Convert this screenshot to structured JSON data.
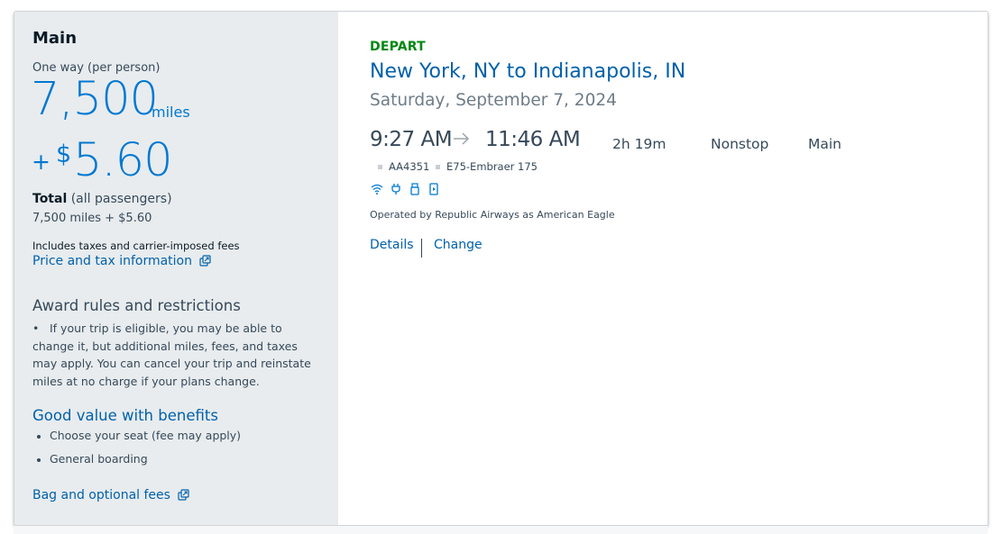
{
  "fare": {
    "cabin_title": "Main",
    "one_way_label": "One way (per person)",
    "miles": "7,500",
    "miles_unit": "miles",
    "plus": "+",
    "currency_symbol": "$",
    "cash": "5.60",
    "total_label": "Total",
    "total_suffix": "(all passengers)",
    "total_value": "7,500 miles + $5.60",
    "includes_text": "Includes taxes and carrier-imposed fees",
    "price_tax_link": "Price and tax information"
  },
  "award": {
    "title": "Award rules and restrictions",
    "rule_text": "If your trip is eligible, you may be able to change it, but additional miles, fees, and taxes may apply. You can cancel your trip and reinstate miles at no charge if your plans change."
  },
  "benefits": {
    "title": "Good value with benefits",
    "items": [
      "Choose your seat (fee may apply)",
      "General boarding"
    ]
  },
  "bag_link": "Bag and optional fees",
  "flight": {
    "depart_label": "DEPART",
    "route": "New York, NY to Indianapolis, IN",
    "date": "Saturday, September 7, 2024",
    "depart_time": "9:27 AM",
    "arrive_time": "11:46 AM",
    "duration": "2h 19m",
    "stops": "Nonstop",
    "cabin": "Main",
    "flight_number": "AA4351",
    "aircraft": "E75-Embraer 175",
    "amenities": [
      "wifi-icon",
      "power-outlet-icon",
      "usb-icon",
      "entertainment-icon"
    ],
    "operated_by": "Operated by Republic Airways as American Eagle",
    "details_link": "Details",
    "change_link": "Change"
  },
  "colors": {
    "primary_blue": "#0078d2",
    "link_blue": "#0061ab",
    "depart_green": "#008712",
    "text": "#36495a",
    "panel_bg": "#e8ecee"
  }
}
